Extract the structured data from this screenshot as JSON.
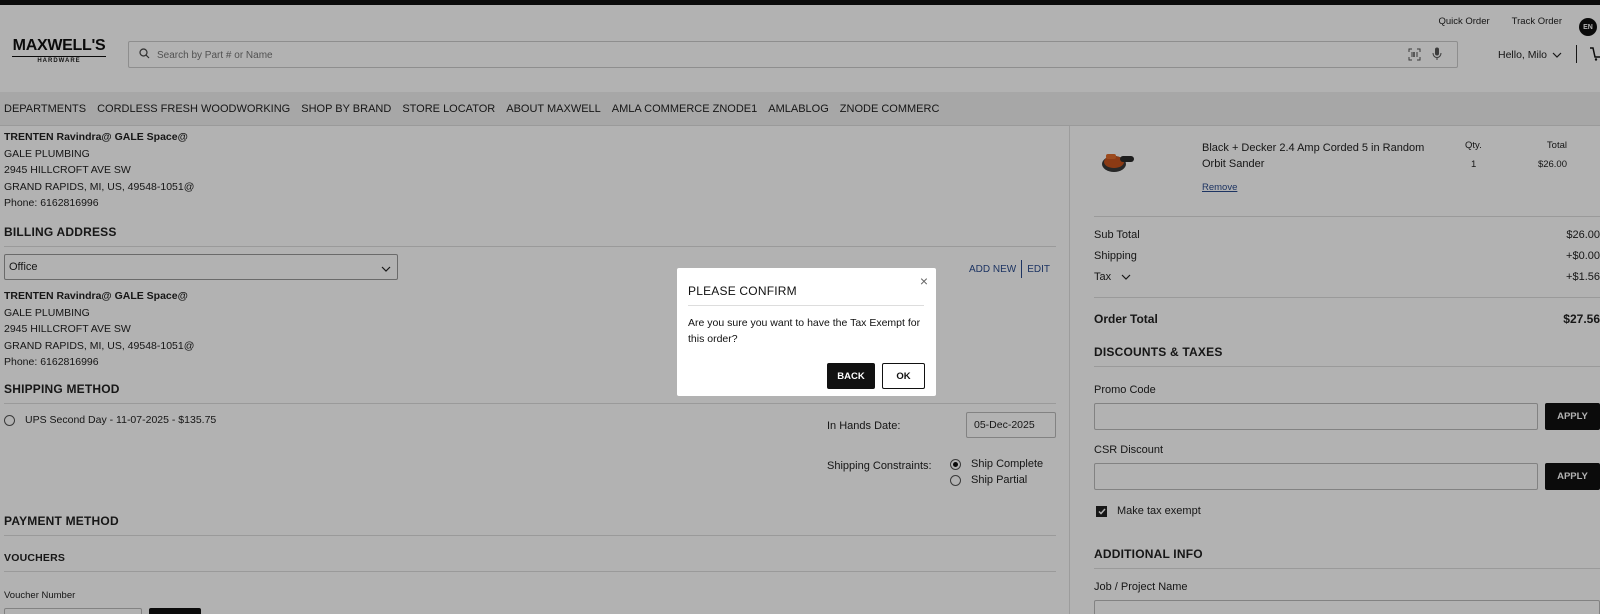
{
  "header": {
    "logo_main": "MAXWELL'S",
    "logo_sub": "HARDWARE",
    "quick_order": "Quick Order",
    "track_order": "Track Order",
    "language": "EN",
    "search_placeholder": "Search by Part # or Name",
    "greeting": "Hello, Milo"
  },
  "nav": {
    "items": [
      "DEPARTMENTS",
      "CORDLESS FRESH WOODWORKING",
      "SHOP BY BRAND",
      "STORE LOCATOR",
      "ABOUT MAXWELL",
      "AMLA COMMERCE ZNODE1",
      "AMLABLOG",
      "ZNODE COMMERC"
    ]
  },
  "shipping_address": {
    "name": "TRENTEN Ravindra@ GALE Space@",
    "company": "GALE PLUMBING",
    "street": "2945 HILLCROFT AVE SW",
    "city": "GRAND RAPIDS, MI, US, 49548-1051@",
    "phone": "Phone: 6162816996"
  },
  "billing": {
    "title": "BILLING ADDRESS",
    "selected": "Office",
    "add_new": "ADD NEW",
    "edit": "EDIT",
    "name": "TRENTEN Ravindra@ GALE Space@",
    "company": "GALE PLUMBING",
    "street": "2945 HILLCROFT AVE SW",
    "city": "GRAND RAPIDS, MI, US, 49548-1051@",
    "phone": "Phone: 6162816996"
  },
  "shipping_method": {
    "title": "SHIPPING METHOD",
    "option": "UPS Second Day - 11-07-2025 - $135.75",
    "in_hands_label": "In Hands Date:",
    "in_hands_value": "05-Dec-2025",
    "constraints_label": "Shipping Constraints:",
    "ship_complete": "Ship Complete",
    "ship_partial": "Ship Partial"
  },
  "payment": {
    "title": "PAYMENT METHOD",
    "vouchers_title": "VOUCHERS",
    "voucher_label": "Voucher Number"
  },
  "cart_item": {
    "name": "Black + Decker 2.4 Amp Corded 5 in Random Orbit Sander",
    "qty_label": "Qty.",
    "qty": "1",
    "total_label": "Total",
    "total": "$26.00",
    "remove": "Remove"
  },
  "summary": {
    "subtotal_label": "Sub Total",
    "subtotal": "$26.00",
    "shipping_label": "Shipping",
    "shipping": "+$0.00",
    "tax_label": "Tax",
    "tax": "+$1.56",
    "order_total_label": "Order Total",
    "order_total": "$27.56"
  },
  "discounts": {
    "title": "DISCOUNTS & TAXES",
    "promo_label": "Promo Code",
    "apply": "APPLY",
    "csr_label": "CSR Discount",
    "apply2": "APPLY",
    "tax_exempt": "Make tax exempt"
  },
  "additional": {
    "title": "ADDITIONAL INFO",
    "job_label": "Job / Project Name"
  },
  "modal": {
    "title": "PLEASE CONFIRM",
    "message": "Are you sure you want to have the Tax Exempt for this order?",
    "back": "BACK",
    "ok": "OK"
  }
}
